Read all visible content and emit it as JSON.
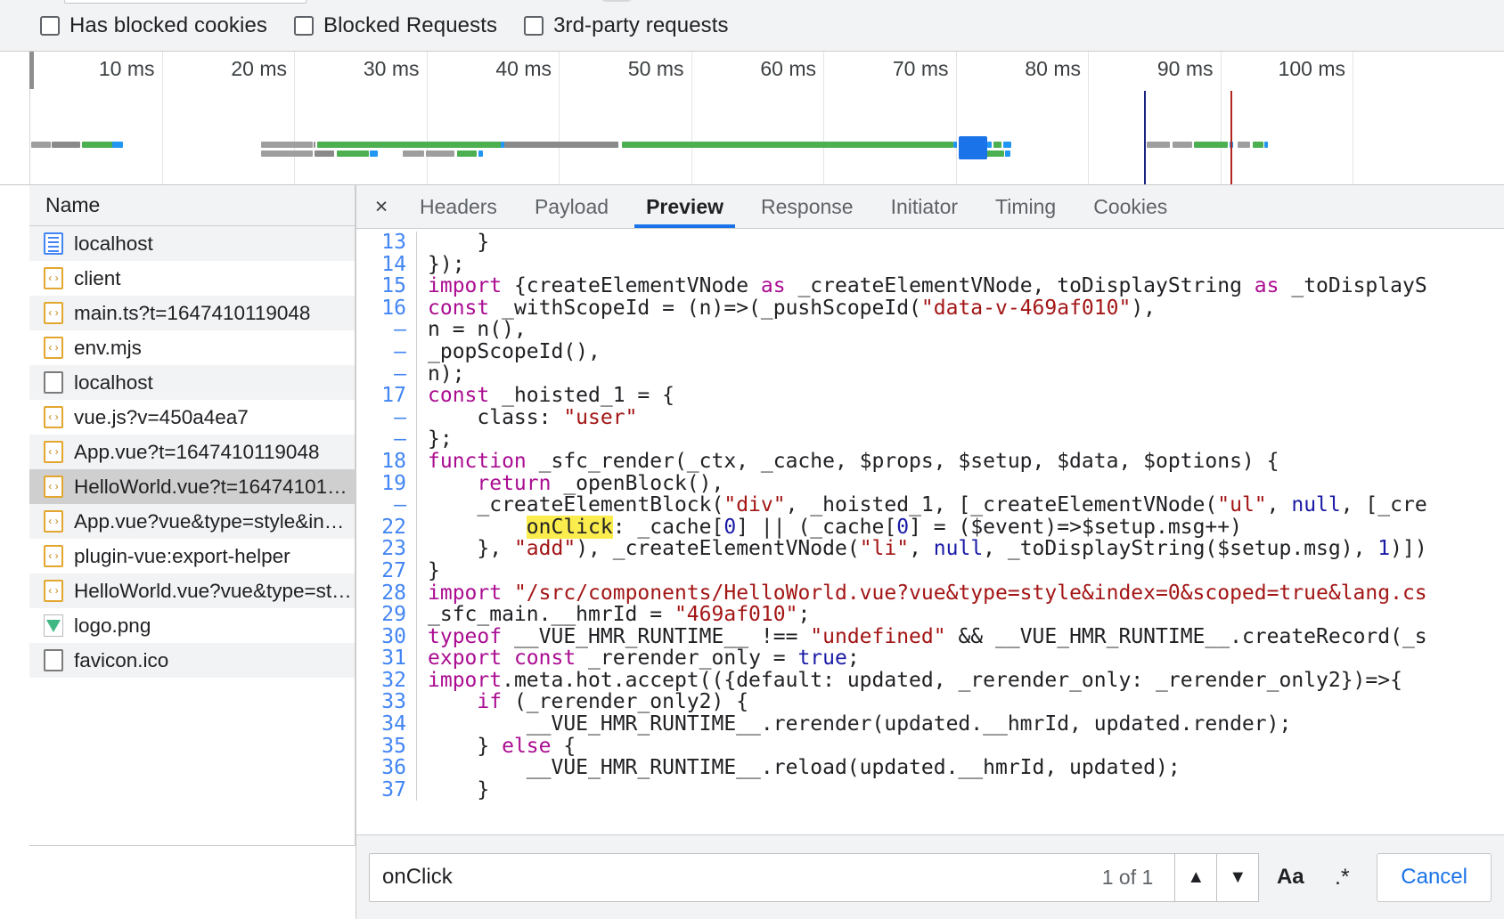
{
  "filterbar": {
    "checkboxes": [
      {
        "label": "Has blocked cookies",
        "checked": false
      },
      {
        "label": "Blocked Requests",
        "checked": false
      },
      {
        "label": "3rd-party requests",
        "checked": false
      }
    ]
  },
  "overview": {
    "ticks": [
      "10 ms",
      "20 ms",
      "30 ms",
      "40 ms",
      "50 ms",
      "60 ms",
      "70 ms",
      "80 ms",
      "90 ms",
      "100 ms"
    ],
    "dom_content_loaded_marker": "#1a237e",
    "load_marker": "#b3261e"
  },
  "requests": {
    "column_header": "Name",
    "rows": [
      {
        "name": "localhost",
        "icon": "document-icon"
      },
      {
        "name": "client",
        "icon": "script-icon"
      },
      {
        "name": "main.ts?t=1647410119048",
        "icon": "script-icon"
      },
      {
        "name": "env.mjs",
        "icon": "script-icon"
      },
      {
        "name": "localhost",
        "icon": "other-icon"
      },
      {
        "name": "vue.js?v=450a4ea7",
        "icon": "script-icon"
      },
      {
        "name": "App.vue?t=1647410119048",
        "icon": "script-icon"
      },
      {
        "name": "HelloWorld.vue?t=16474101…",
        "icon": "script-icon",
        "selected": true
      },
      {
        "name": "App.vue?vue&type=style&in…",
        "icon": "script-icon"
      },
      {
        "name": "plugin-vue:export-helper",
        "icon": "script-icon"
      },
      {
        "name": "HelloWorld.vue?vue&type=st…",
        "icon": "script-icon"
      },
      {
        "name": "logo.png",
        "icon": "image-icon"
      },
      {
        "name": "favicon.ico",
        "icon": "other-icon"
      }
    ]
  },
  "detail": {
    "close_label": "×",
    "tabs": [
      {
        "label": "Headers",
        "active": false
      },
      {
        "label": "Payload",
        "active": false
      },
      {
        "label": "Preview",
        "active": true
      },
      {
        "label": "Response",
        "active": false
      },
      {
        "label": "Initiator",
        "active": false
      },
      {
        "label": "Timing",
        "active": false
      },
      {
        "label": "Cookies",
        "active": false
      }
    ]
  },
  "code_lines": [
    {
      "num": "13",
      "html": "    }"
    },
    {
      "num": "14",
      "html": "});"
    },
    {
      "num": "15",
      "html": "<span class=\"kw\">import</span> {createElementVNode <span class=\"kw\">as</span> _createElementVNode, toDisplayString <span class=\"kw\">as</span> _toDisplayS"
    },
    {
      "num": "16",
      "html": "<span class=\"kw\">const</span> _withScopeId = (n)=&gt;(_pushScopeId(<span class=\"str\">\"data-v-469af010\"</span>),"
    },
    {
      "num": "–",
      "html": "n = n(),"
    },
    {
      "num": "–",
      "html": "_popScopeId(),"
    },
    {
      "num": "–",
      "html": "n);"
    },
    {
      "num": "17",
      "html": "<span class=\"kw\">const</span> _hoisted_1 = {"
    },
    {
      "num": "–",
      "html": "    class: <span class=\"str\">\"user\"</span>"
    },
    {
      "num": "–",
      "html": "};"
    },
    {
      "num": "18",
      "html": "<span class=\"kw\">function</span> _sfc_render(_ctx, _cache, $props, $setup, $data, $options) {"
    },
    {
      "num": "19",
      "html": "    <span class=\"kw\">return</span> _openBlock(),"
    },
    {
      "num": "–",
      "html": "    _createElementBlock(<span class=\"str\">\"div\"</span>, _hoisted_1, [_createElementVNode(<span class=\"str\">\"ul\"</span>, <span class=\"bl\">null</span>, [_cre"
    },
    {
      "num": "22",
      "html": "        <span class=\"hl\">onClick</span>: _cache[<span class=\"num\">0</span>] || (_cache[<span class=\"num\">0</span>] = ($event)=&gt;$setup.msg++)"
    },
    {
      "num": "23",
      "html": "    }, <span class=\"str\">\"add\"</span>), _createElementVNode(<span class=\"str\">\"li\"</span>, <span class=\"bl\">null</span>, _toDisplayString($setup.msg), <span class=\"num\">1</span>)])"
    },
    {
      "num": "27",
      "html": "}"
    },
    {
      "num": "28",
      "html": "<span class=\"kw\">import</span> <span class=\"str\">\"/src/components/HelloWorld.vue?vue&amp;type=style&amp;index=0&amp;scoped=true&amp;lang.cs</span>"
    },
    {
      "num": "29",
      "html": "_sfc_main.__hmrId = <span class=\"str\">\"469af010\"</span>;"
    },
    {
      "num": "30",
      "html": "<span class=\"kw\">typeof</span> __VUE_HMR_RUNTIME__ !== <span class=\"str\">\"undefined\"</span> &amp;&amp; __VUE_HMR_RUNTIME__.createRecord(_s"
    },
    {
      "num": "31",
      "html": "<span class=\"kw\">export</span> <span class=\"kw\">const</span> _rerender_only = <span class=\"bl\">true</span>;"
    },
    {
      "num": "32",
      "html": "<span class=\"kw\">import</span>.meta.hot.accept(({default: updated, _rerender_only: _rerender_only2})=&gt;{"
    },
    {
      "num": "33",
      "html": "    <span class=\"kw\">if</span> (_rerender_only2) {"
    },
    {
      "num": "34",
      "html": "        __VUE_HMR_RUNTIME__.rerender(updated.__hmrId, updated.render);"
    },
    {
      "num": "35",
      "html": "    } <span class=\"kw\">else</span> {"
    },
    {
      "num": "36",
      "html": "        __VUE_HMR_RUNTIME__.reload(updated.__hmrId, updated);"
    },
    {
      "num": "37",
      "html": "    }"
    }
  ],
  "search": {
    "value": "onClick",
    "match_count": "1 of 1",
    "prev_label": "▲",
    "next_label": "▼",
    "match_case_label": "Aa",
    "regex_label": ".*",
    "cancel_label": "Cancel"
  }
}
